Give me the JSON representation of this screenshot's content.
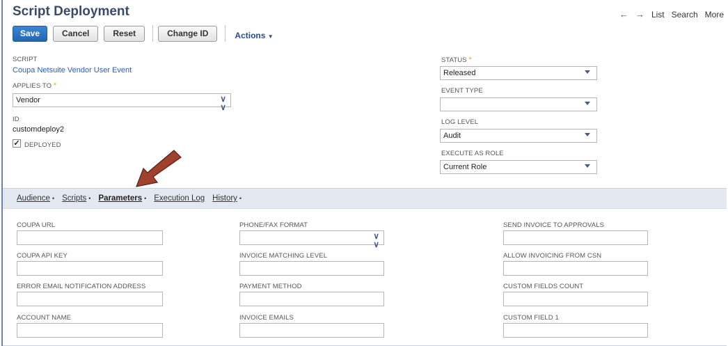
{
  "header": {
    "title": "Script Deployment",
    "nav": {
      "list": "List",
      "search": "Search",
      "more": "More"
    }
  },
  "toolbar": {
    "save": "Save",
    "cancel": "Cancel",
    "reset": "Reset",
    "change_id": "Change ID",
    "actions": "Actions"
  },
  "fields": {
    "script_label": "SCRIPT",
    "script_value": "Coupa Netsuite Vendor User Event",
    "applies_to_label": "APPLIES TO",
    "applies_to_value": "Vendor",
    "id_label": "ID",
    "id_value": "customdeploy2",
    "deployed_label": "DEPLOYED",
    "status_label": "STATUS",
    "status_value": "Released",
    "event_type_label": "EVENT TYPE",
    "event_type_value": "",
    "log_level_label": "LOG LEVEL",
    "log_level_value": "Audit",
    "execute_as_role_label": "EXECUTE AS ROLE",
    "execute_as_role_value": "Current Role"
  },
  "tabs": [
    {
      "label": "Audience",
      "active": false
    },
    {
      "label": "Scripts",
      "active": false
    },
    {
      "label": "Parameters",
      "active": true
    },
    {
      "label": "Execution Log",
      "active": false
    },
    {
      "label": "History",
      "active": false
    }
  ],
  "parameters": {
    "col1": [
      "COUPA URL",
      "COUPA API KEY",
      "ERROR EMAIL NOTIFICATION ADDRESS",
      "ACCOUNT NAME"
    ],
    "col2": [
      "PHONE/FAX FORMAT",
      "INVOICE MATCHING LEVEL",
      "PAYMENT METHOD",
      "INVOICE EMAILS"
    ],
    "col3": [
      "SEND INVOICE TO APPROVALS",
      "ALLOW INVOICING FROM CSN",
      "CUSTOM FIELDS COUNT",
      "CUSTOM FIELD 1"
    ]
  },
  "colors": {
    "accent": "#2466b0",
    "arrow": "#a0412d",
    "tabbar": "#e4e9f1"
  }
}
